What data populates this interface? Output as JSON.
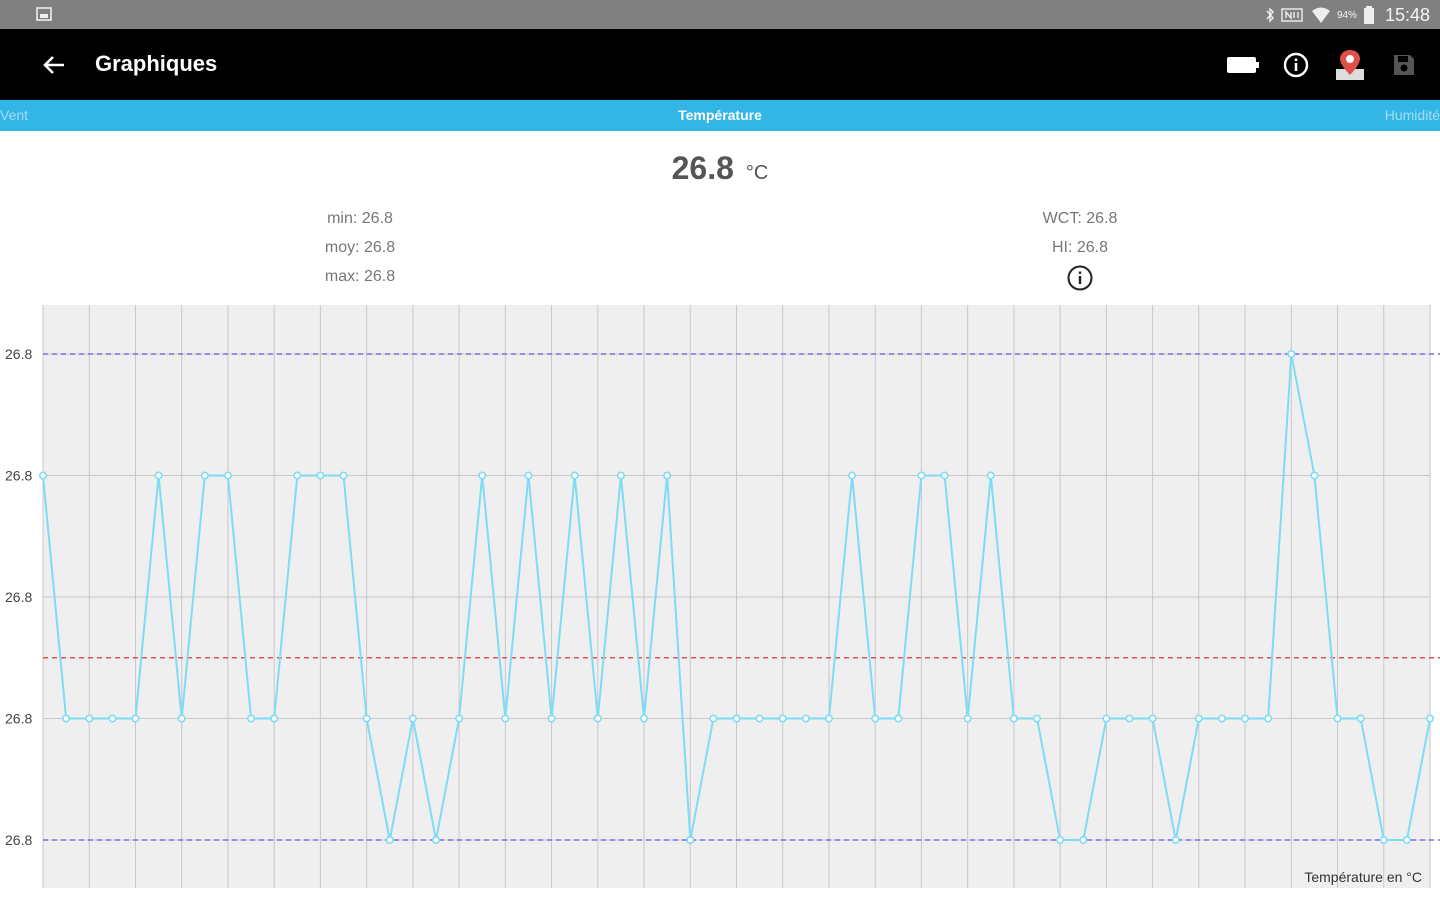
{
  "status_bar": {
    "time": "15:48",
    "battery_percent": "94%",
    "icons": [
      "gallery-icon",
      "bluetooth-icon",
      "nfc-icon",
      "wifi-icon",
      "battery-icon"
    ]
  },
  "toolbar": {
    "title": "Graphiques",
    "icons": [
      "back-arrow-icon",
      "battery-icon",
      "info-icon",
      "map-pin-icon",
      "save-icon"
    ]
  },
  "tabs": {
    "left": "Vent",
    "center": "Température",
    "right": "Humidité"
  },
  "current": {
    "value": "26.8",
    "unit": "°C"
  },
  "stats_left": {
    "min": "min: 26.8",
    "avg": "moy: 26.8",
    "max": "max: 26.8"
  },
  "stats_right": {
    "wct": "WCT: 26.8",
    "hi": "HI: 26.8"
  },
  "colors": {
    "line": "#7fdcf5",
    "bounds": "#7b6fe6",
    "average": "#e0505a",
    "accent": "#33b5e5"
  },
  "chart_data": {
    "type": "line",
    "ylabel": "Température en °C",
    "y_tick_labels": [
      "26.8",
      "26.8",
      "26.8",
      "26.8",
      "26.8"
    ],
    "ylim": [
      0,
      4.5
    ],
    "grid": true,
    "reference_lines": [
      {
        "name": "max",
        "value": 4,
        "style": "dashed"
      },
      {
        "name": "average",
        "value": 1.5,
        "style": "dashed"
      },
      {
        "name": "min",
        "value": 0,
        "style": "dashed"
      }
    ],
    "series": [
      {
        "values": [
          3,
          1,
          1,
          1,
          1,
          3,
          1,
          3,
          3,
          1,
          1,
          3,
          3,
          3,
          1,
          0,
          1,
          0,
          1,
          3,
          1,
          3,
          1,
          3,
          1,
          3,
          1,
          3,
          0,
          1,
          1,
          1,
          1,
          1,
          1,
          3,
          1,
          1,
          3,
          3,
          1,
          3,
          1,
          1,
          0,
          0,
          1,
          1,
          1,
          0,
          1,
          1,
          1,
          1,
          4,
          3,
          1,
          1,
          0,
          0,
          1
        ]
      }
    ]
  }
}
